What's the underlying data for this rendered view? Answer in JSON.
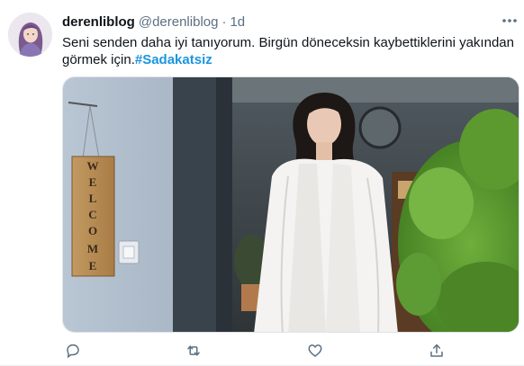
{
  "tweet": {
    "display_name": "derenliblog",
    "handle": "@derenliblog",
    "separator": "·",
    "time": "1d",
    "text_main": "Seni senden daha  iyi tanıyorum. Birgün döneceksin kaybettiklerini yakından görmek için.",
    "hashtag": "#Sadakatsiz",
    "sign_letters": [
      "W",
      "E",
      "L",
      "C",
      "O",
      "M",
      "E"
    ]
  },
  "icons": {
    "more": "more-horizontal-icon",
    "reply": "reply-icon",
    "retweet": "retweet-icon",
    "like": "heart-icon",
    "share": "share-icon"
  },
  "colors": {
    "text": "#0f1419",
    "secondary": "#5b7083",
    "hashtag": "#1b95e0"
  }
}
